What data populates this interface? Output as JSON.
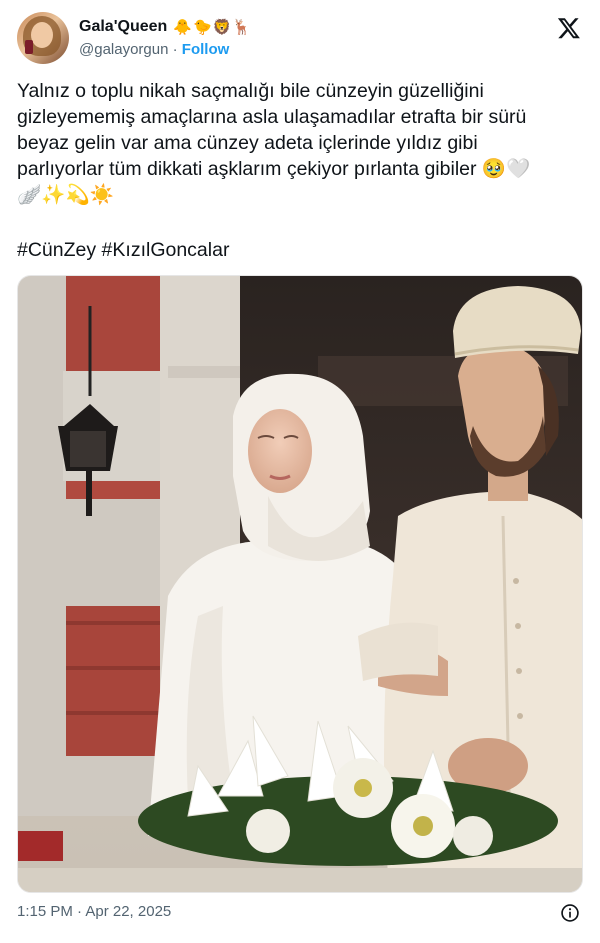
{
  "author": {
    "display_name": "Gala'Queen",
    "name_emojis": "🐥🐤🦁🦌",
    "handle": "@galayorgun",
    "separator": "·",
    "follow_label": "Follow"
  },
  "post": {
    "text": "Yalnız o toplu nikah saçmalığı bile cünzeyin güzelliğini\ngizleyememiş amaçlarına asla ulaşamadılar etrafta bir sürü\nbeyaz gelin var ama cünzey adeta içlerinde yıldız gibi\nparlıyorlar tüm dikkati aşklarım çekiyor pırlanta gibiler 🥹🤍\n🪽✨💫☀️",
    "hashtags": [
      "#CünZey",
      "#KızılGoncalar"
    ],
    "timestamp": "1:15 PM · Apr 22, 2025"
  },
  "icons": {
    "platform": "x-logo-icon",
    "info": "info-icon"
  }
}
